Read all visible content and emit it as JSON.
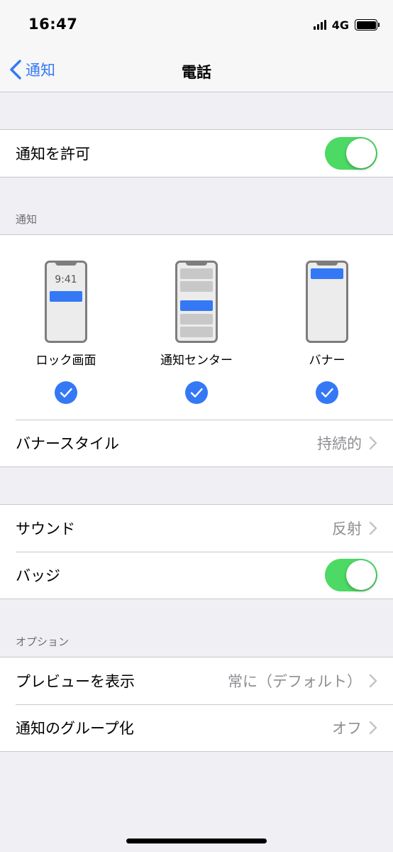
{
  "status": {
    "time": "16:47",
    "network": "4G"
  },
  "nav": {
    "back_label": "通知",
    "title": "電話"
  },
  "allow": {
    "label": "通知を許可",
    "enabled": true
  },
  "alerts": {
    "header": "通知",
    "styles": [
      {
        "label": "ロック画面",
        "preview_time": "9:41",
        "checked": true
      },
      {
        "label": "通知センター",
        "checked": true
      },
      {
        "label": "バナー",
        "checked": true
      }
    ],
    "banner_style": {
      "label": "バナースタイル",
      "value": "持続的"
    }
  },
  "sounds": {
    "sound": {
      "label": "サウンド",
      "value": "反射"
    },
    "badges": {
      "label": "バッジ",
      "enabled": true
    }
  },
  "options": {
    "header": "オプション",
    "preview": {
      "label": "プレビューを表示",
      "value": "常に（デフォルト）"
    },
    "grouping": {
      "label": "通知のグループ化",
      "value": "オフ"
    }
  },
  "colors": {
    "accent": "#3478f6",
    "toggle_on": "#4cd964",
    "background": "#efeff4"
  }
}
